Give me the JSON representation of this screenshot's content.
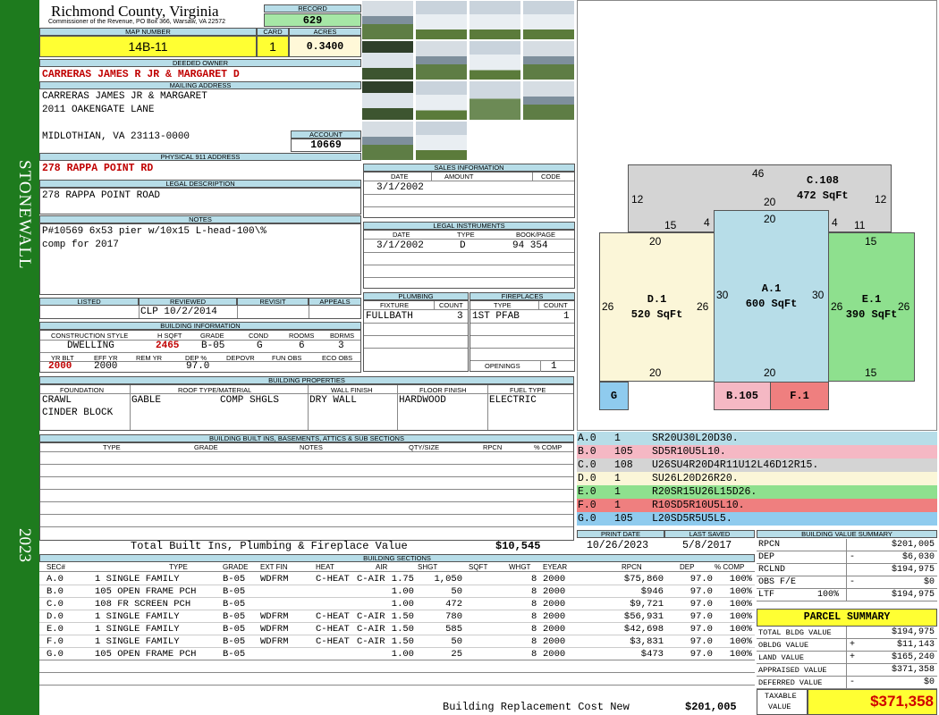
{
  "header": {
    "county": "Richmond County, Virginia",
    "commissioner": "Commissioner of the Revenue, PO Box 366, Warsaw, VA 22572",
    "record_label": "RECORD",
    "record": "629",
    "map_label": "MAP NUMBER",
    "map_number": "14B-11",
    "card_label": "CARD",
    "card": "1",
    "acres_label": "ACRES",
    "acres": "0.3400"
  },
  "sidebar": {
    "brand": "STONEWALL",
    "year": "2023"
  },
  "owner": {
    "deeded_label": "DEEDED OWNER",
    "deeded": "CARRERAS JAMES R JR & MARGARET D",
    "mailing_label": "MAILING ADDRESS",
    "line1": "CARRERAS JAMES JR & MARGARET",
    "line2": "2011 OAKENGATE LANE",
    "line3": "MIDLOTHIAN, VA 23113-0000",
    "account_label": "ACCOUNT",
    "account": "10669"
  },
  "physical": {
    "label": "PHYSICAL 911 ADDRESS",
    "value": "278 RAPPA POINT RD"
  },
  "legal": {
    "label": "LEGAL DESCRIPTION",
    "value": "278 RAPPA POINT ROAD"
  },
  "notes": {
    "label": "NOTES",
    "line1": "P#10569 6x53 pier w/10x15 L-head-100\\%",
    "line2": "comp for 2017"
  },
  "sales": {
    "label": "SALES INFORMATION",
    "h_date": "DATE",
    "h_amount": "AMOUNT",
    "h_code": "CODE",
    "date": "3/1/2002"
  },
  "instruments": {
    "label": "LEGAL INSTRUMENTS",
    "h_date": "DATE",
    "h_type": "TYPE",
    "h_book": "BOOK/PAGE",
    "date": "3/1/2002",
    "type": "D",
    "book": "94 354"
  },
  "review": {
    "h_listed": "LISTED",
    "h_reviewed": "REVIEWED",
    "h_revisit": "REVISIT",
    "h_appeals": "APPEALS",
    "reviewed": "CLP  10/2/2014"
  },
  "plumbing": {
    "label": "PLUMBING",
    "h_fixture": "FIXTURE",
    "h_count": "COUNT",
    "fixture": "FULLBATH",
    "count": "3"
  },
  "fireplaces": {
    "label": "FIREPLACES",
    "h_type": "TYPE",
    "h_count": "COUNT",
    "type": "1ST PFAB",
    "count": "1",
    "openings_label": "OPENINGS",
    "openings": "1"
  },
  "building": {
    "label": "BUILDING INFORMATION",
    "h_style": "CONSTRUCTION STYLE",
    "h_hsqft": "H SQFT",
    "h_grade": "GRADE",
    "h_cond": "COND",
    "h_rooms": "ROOMS",
    "h_bdrms": "BDRMS",
    "style": "DWELLING",
    "hsqft": "2465",
    "grade": "B-05",
    "cond": "G",
    "rooms": "6",
    "bdrms": "3",
    "h_yrblt": "YR BLT",
    "h_effyr": "EFF YR",
    "h_remyr": "REM YR",
    "h_dep": "DEP %",
    "h_depovr": "DEPOVR",
    "h_funobs": "FUN OBS",
    "h_ecoobs": "ECO OBS",
    "yrblt": "2000",
    "effyr": "2000",
    "dep": "97.0"
  },
  "properties": {
    "label": "BUILDING PROPERTIES",
    "h_foundation": "FOUNDATION",
    "h_roof": "ROOF TYPE/MATERIAL",
    "h_wall": "WALL FINISH",
    "h_floor": "FLOOR FINISH",
    "h_fuel": "FUEL TYPE",
    "foundation1": "CRAWL",
    "foundation2": "CINDER BLOCK",
    "roof_type": "GABLE",
    "roof_mat": "COMP SHGLS",
    "wall": "DRY WALL",
    "floor": "HARDWOOD",
    "fuel": "ELECTRIC"
  },
  "builtins": {
    "label": "BUILDING BUILT INS, BASEMENTS, ATTICS & SUB SECTIONS",
    "h_type": "TYPE",
    "h_grade": "GRADE",
    "h_notes": "NOTES",
    "h_qty": "QTY/SIZE",
    "h_rpcn": "RPCN",
    "h_comp": "% COMP",
    "total_label": "Total Built Ins, Plumbing & Fireplace Value",
    "total": "$10,545"
  },
  "sketch": {
    "areas": [
      {
        "code": "C.108",
        "sqft": "472 SqFt"
      },
      {
        "code": "D.1",
        "sqft": "520 SqFt"
      },
      {
        "code": "A.1",
        "sqft": "600 SqFt"
      },
      {
        "code": "E.1",
        "sqft": "390 SqFt"
      },
      {
        "code": "G",
        "sqft": ""
      },
      {
        "code": "B.105",
        "sqft": ""
      },
      {
        "code": "F.1",
        "sqft": ""
      }
    ],
    "dims": [
      "46",
      "12",
      "20",
      "12",
      "15",
      "4",
      "20",
      "4",
      "11",
      "20",
      "15",
      "26",
      "26",
      "30",
      "30",
      "26",
      "26",
      "20",
      "20",
      "15"
    ]
  },
  "legend": [
    {
      "sec": "A.0",
      "n": "1",
      "cmd": "SR20U30L20D30.",
      "color": "#b7dde8"
    },
    {
      "sec": "B.0",
      "n": "105",
      "cmd": "SD5R10U5L10.",
      "color": "#f5b8c4"
    },
    {
      "sec": "C.0",
      "n": "108",
      "cmd": "U26SU4R20D4R11U12L46D12R15.",
      "color": "#d4d4d4"
    },
    {
      "sec": "D.0",
      "n": "1",
      "cmd": "SU26L20D26R20.",
      "color": "#fbf6d8"
    },
    {
      "sec": "E.0",
      "n": "1",
      "cmd": "R20SR15U26L15D26.",
      "color": "#8ee08e"
    },
    {
      "sec": "F.0",
      "n": "1",
      "cmd": "R10SD5R10U5L10.",
      "color": "#ef7f7f"
    },
    {
      "sec": "G.0",
      "n": "105",
      "cmd": "L20SD5R5U5L5.",
      "color": "#8fcbee"
    }
  ],
  "dates": {
    "h_print": "PRINT DATE",
    "h_saved": "LAST SAVED",
    "print": "10/26/2023",
    "saved": "5/8/2017"
  },
  "value_summary": {
    "label": "BUILDING VALUE SUMMARY",
    "rows": [
      {
        "k": "RPCN",
        "s": "",
        "v": "$201,005"
      },
      {
        "k": "DEP",
        "s": "-",
        "v": "$6,030"
      },
      {
        "k": "RCLND",
        "s": "",
        "v": "$194,975"
      },
      {
        "k": "OBS F/E",
        "s": "-",
        "v": "$0"
      },
      {
        "k": "LTF",
        "s": "100%",
        "v": "$194,975"
      }
    ]
  },
  "parcel": {
    "label": "PARCEL SUMMARY",
    "rows": [
      {
        "k": "TOTAL BLDG VALUE",
        "s": "",
        "v": "$194,975"
      },
      {
        "k": "OBLDG VALUE",
        "s": "+",
        "v": "$11,143"
      },
      {
        "k": "LAND VALUE",
        "s": "+",
        "v": "$165,240"
      },
      {
        "k": "APPRAISED VALUE",
        "s": "",
        "v": "$371,358"
      },
      {
        "k": "DEFERRED VALUE",
        "s": "-",
        "v": "$0"
      }
    ],
    "taxable_label1": "TAXABLE",
    "taxable_label2": "VALUE",
    "taxable": "$371,358"
  },
  "sections": {
    "label": "BUILDING SECTIONS",
    "headers": [
      "SEC#",
      "TYPE",
      "GRADE",
      "EXT FIN",
      "HEAT",
      "AIR",
      "SHGT",
      "SQFT",
      "WHGT",
      "EYEAR",
      "RPCN",
      "DEP",
      "% COMP"
    ],
    "rows": [
      [
        "A.0",
        "1 SINGLE FAMILY",
        "B-05",
        "WDFRM",
        "C-HEAT",
        "C-AIR",
        "1.75",
        "1,050",
        "8",
        "2000",
        "$75,860",
        "97.0",
        "100%"
      ],
      [
        "B.0",
        "105 OPEN FRAME PCH",
        "B-05",
        "",
        "",
        "",
        "1.00",
        "50",
        "8",
        "2000",
        "$946",
        "97.0",
        "100%"
      ],
      [
        "C.0",
        "108 FR SCREEN PCH",
        "B-05",
        "",
        "",
        "",
        "1.00",
        "472",
        "8",
        "2000",
        "$9,721",
        "97.0",
        "100%"
      ],
      [
        "D.0",
        "1 SINGLE FAMILY",
        "B-05",
        "WDFRM",
        "C-HEAT",
        "C-AIR",
        "1.50",
        "780",
        "8",
        "2000",
        "$56,931",
        "97.0",
        "100%"
      ],
      [
        "E.0",
        "1 SINGLE FAMILY",
        "B-05",
        "WDFRM",
        "C-HEAT",
        "C-AIR",
        "1.50",
        "585",
        "8",
        "2000",
        "$42,698",
        "97.0",
        "100%"
      ],
      [
        "F.0",
        "1 SINGLE FAMILY",
        "B-05",
        "WDFRM",
        "C-HEAT",
        "C-AIR",
        "1.50",
        "50",
        "8",
        "2000",
        "$3,831",
        "97.0",
        "100%"
      ],
      [
        "G.0",
        "105 OPEN FRAME PCH",
        "B-05",
        "",
        "",
        "",
        "1.00",
        "25",
        "8",
        "2000",
        "$473",
        "97.0",
        "100%"
      ]
    ],
    "total_label": "Building Replacement Cost New",
    "total": "$201,005"
  },
  "photos": [
    "waterfront-photo",
    "house-photo",
    "house-photo",
    "house-photo",
    "house-photo",
    "waterfront-photo",
    "porch-photo",
    "waterfront-photo",
    "house-photo",
    "house-photo",
    "house-photo",
    "pier-photo",
    "waterfront-photo",
    "house-photo"
  ]
}
